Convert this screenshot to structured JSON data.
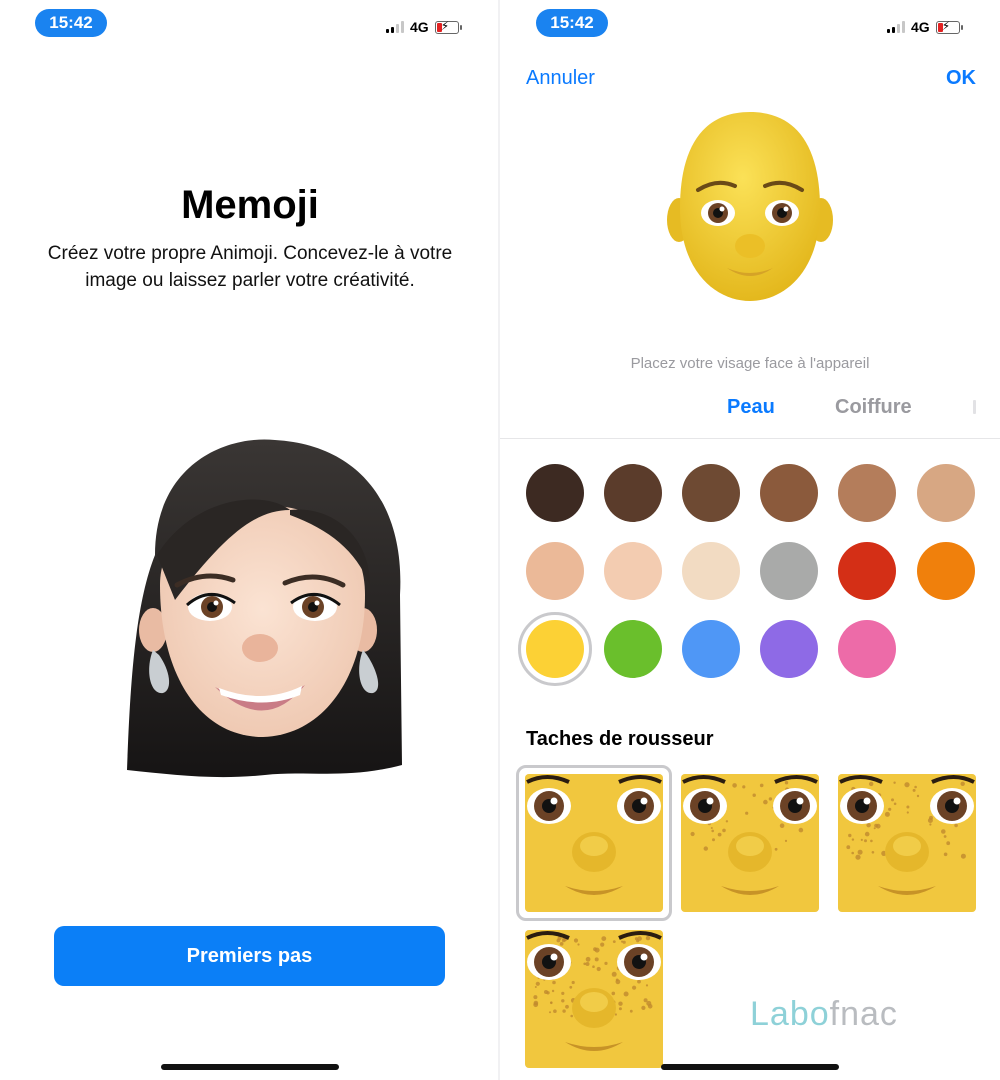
{
  "status_bar": {
    "time": "15:42",
    "network": "4G",
    "accent_color": "#1a83f0",
    "battery_color": "#e32222"
  },
  "intro_screen": {
    "title": "Memoji",
    "description_line1": "Créez votre propre Animoji. Concevez-le à votre",
    "description_line2": "image ou laissez parler votre créativité.",
    "start_button_label": "Premiers pas",
    "button_color": "#0b7ff7"
  },
  "editor_screen": {
    "cancel_label": "Annuler",
    "ok_label": "OK",
    "face_hint": "Placez votre visage face à l'appareil",
    "tabs": [
      {
        "label": "Peau",
        "active": true
      },
      {
        "label": "Coiffure",
        "active": false
      }
    ],
    "skin_swatches": [
      {
        "color": "#3d2a22"
      },
      {
        "color": "#5b3c2b"
      },
      {
        "color": "#6e4a33"
      },
      {
        "color": "#8b5a3c"
      },
      {
        "color": "#b47d5b"
      },
      {
        "color": "#d7a783"
      },
      {
        "color": "#ebb998"
      },
      {
        "color": "#f3ccb1"
      },
      {
        "color": "#f2dbc2"
      },
      {
        "color": "#a9aaa9"
      },
      {
        "color": "#d42f16"
      },
      {
        "color": "#f0800c"
      },
      {
        "color": "#fcd135",
        "selected": true
      },
      {
        "color": "#6abf2c"
      },
      {
        "color": "#4f97f6"
      },
      {
        "color": "#8e6ae6"
      },
      {
        "color": "#ed6ba8"
      }
    ],
    "freckles_section_title": "Taches de rousseur",
    "freckle_options": [
      {
        "density": 0,
        "selected": true
      },
      {
        "density": 1
      },
      {
        "density": 2
      },
      {
        "density": 3
      }
    ],
    "watermark_part1": "Labo",
    "watermark_part2": "fnac"
  }
}
